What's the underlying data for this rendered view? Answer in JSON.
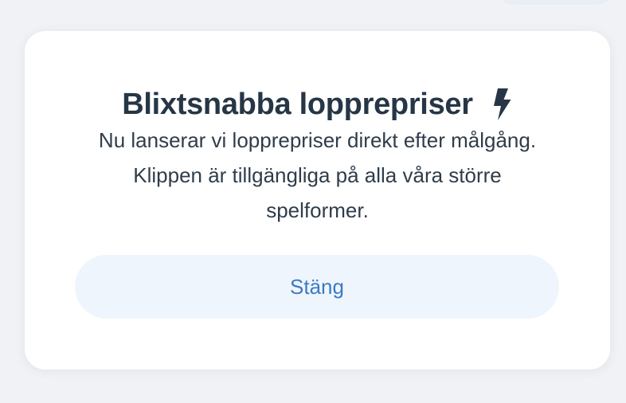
{
  "modal": {
    "title": "Blixtsnabba lopprepriser",
    "title_icon": "lightning-bolt-icon",
    "message_line1": "Nu lanserar vi lopprepriser direkt efter målgång.",
    "message_line2": "Klippen är tillgängliga på alla våra större",
    "message_line3": "spelformer.",
    "close_label": "Stäng"
  },
  "colors": {
    "background": "#f1f2f6",
    "card": "#ffffff",
    "title_text": "#263646",
    "body_text": "#2f3d4b",
    "button_background": "#eff5fd",
    "button_text": "#3a7bc4"
  }
}
